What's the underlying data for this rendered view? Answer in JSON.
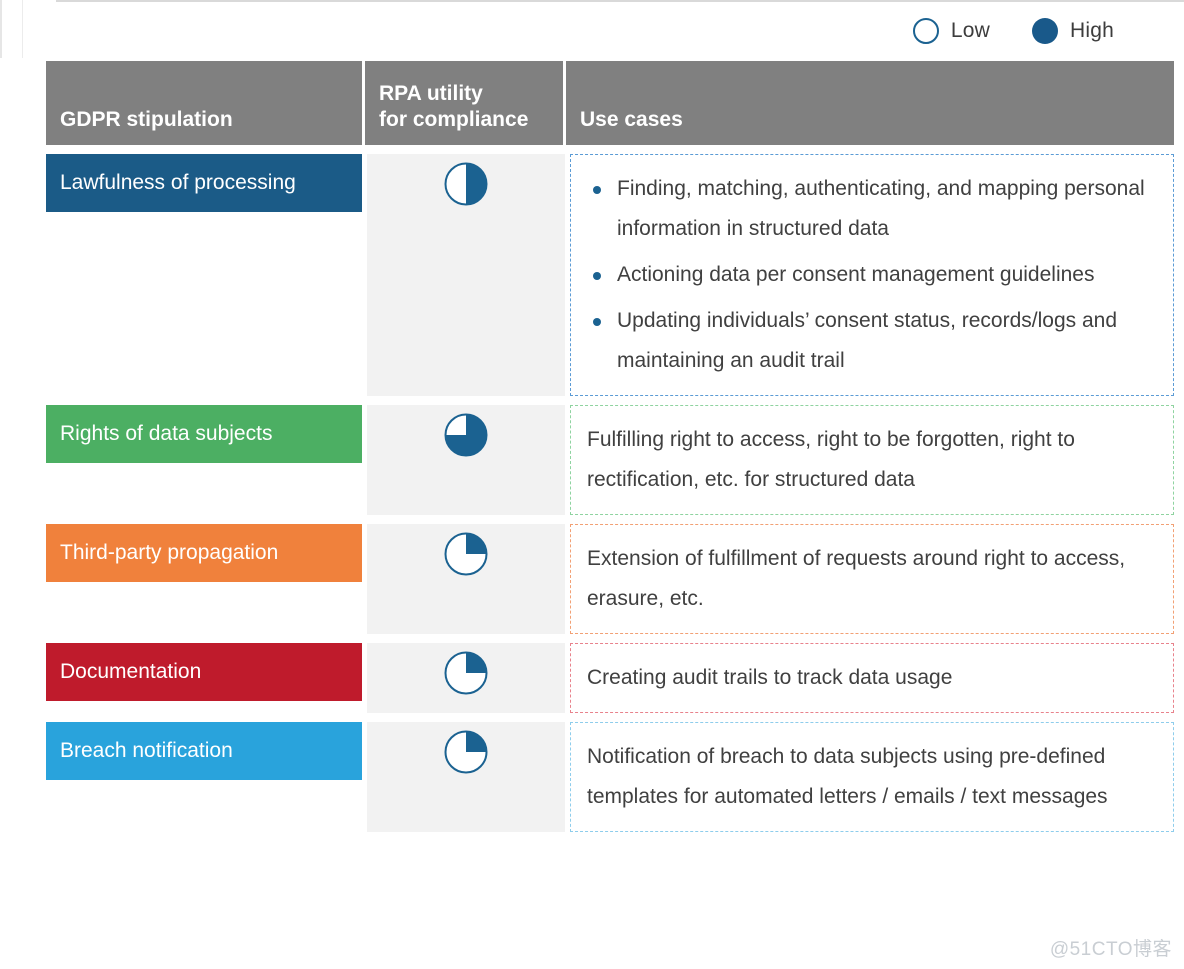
{
  "legend": {
    "items": [
      {
        "label": "Low",
        "style": "outline",
        "color": "#1b6291"
      },
      {
        "label": "High",
        "style": "filled",
        "color": "#19598a"
      }
    ]
  },
  "table": {
    "headers": [
      {
        "label": "GDPR stipulation"
      },
      {
        "label": "RPA utility\nfor compliance"
      },
      {
        "label": "Use cases"
      }
    ],
    "header_bg": "#808080",
    "rpa_cell_bg": "#f2f2f2",
    "pie_color": "#1b6291",
    "rows": [
      {
        "stipulation": "Lawfulness of processing",
        "color": "#1b5b87",
        "rpa_utility_percent": 50,
        "border_color": "#5b9bd5",
        "use_case_type": "list",
        "use_cases": [
          "Finding, matching, authenticating, and mapping personal information in structured data",
          "Actioning data per consent management guidelines",
          "Updating individuals’ consent status, records/logs and maintaining an audit trail"
        ]
      },
      {
        "stipulation": "Rights of data subjects",
        "color": "#4caf63",
        "rpa_utility_percent": 75,
        "border_color": "#8fd3a0",
        "use_case_type": "text",
        "use_cases": [
          "Fulfilling right to access, right to be forgotten, right to rectification, etc. for structured data"
        ]
      },
      {
        "stipulation": "Third-party propagation",
        "color": "#f0813c",
        "rpa_utility_percent": 25,
        "border_color": "#f2a074",
        "use_case_type": "text",
        "use_cases": [
          "Extension of fulfillment of requests around right to access, erasure, etc."
        ]
      },
      {
        "stipulation": "Documentation",
        "color": "#bf1b2c",
        "rpa_utility_percent": 25,
        "border_color": "#e8828c",
        "use_case_type": "text",
        "use_cases": [
          "Creating audit trails to track data usage"
        ]
      },
      {
        "stipulation": "Breach notification",
        "color": "#29a3dc",
        "rpa_utility_percent": 25,
        "border_color": "#8ecdec",
        "use_case_type": "text",
        "use_cases": [
          "Notification of breach to data subjects using pre-defined templates for automated letters / emails / text messages"
        ]
      }
    ]
  },
  "watermark": "@51CTO博客"
}
